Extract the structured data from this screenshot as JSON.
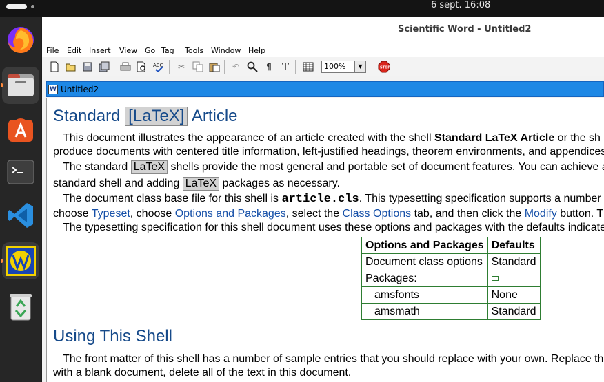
{
  "system": {
    "clock": "6 sept.  16:08"
  },
  "dock": {
    "items": [
      {
        "name": "firefox",
        "icon": "firefox-icon"
      },
      {
        "name": "files",
        "icon": "files-icon"
      },
      {
        "name": "app-center",
        "icon": "app-center-icon"
      },
      {
        "name": "terminal",
        "icon": "terminal-icon"
      },
      {
        "name": "vscode",
        "icon": "vscode-icon"
      },
      {
        "name": "scientific-word",
        "icon": "scientific-word-icon"
      },
      {
        "name": "trash",
        "icon": "trash-icon"
      }
    ]
  },
  "window": {
    "title": "Scientific Word - Untitled2",
    "menu": [
      "File",
      "Edit",
      "Insert",
      "View",
      "Go",
      "Tag",
      "Tools",
      "Window",
      "Help"
    ],
    "zoom": "100%",
    "doc_tab": "Untitled2"
  },
  "document": {
    "h1_pre": "Standard ",
    "h1_tag": "[LaTeX]",
    "h1_post": " Article",
    "p1a_pre": "This document illustrates the appearance of an article created with the shell ",
    "p1a_bold": "Standard LaTeX Article",
    "p1a_post": " or the sh",
    "p1b": "produce documents with centered title information, left-justified headings, theorem environments, and appendices.",
    "p2a_pre": "The standard ",
    "latex": "LaTeX",
    "p2a_post": " shells provide the most general and portable set of document features. You can achieve a",
    "p2b_pre": "standard shell and adding ",
    "p2b_post": " packages as necessary.",
    "p3a_pre": "The document class base file for this shell is ",
    "p3a_code": "article.cls",
    "p3a_post": ". This typesetting specification supports a number",
    "p3b_pre": "choose ",
    "p3b_link1": "Typeset",
    "p3b_mid1": ", choose ",
    "p3b_link2": "Options and Packages",
    "p3b_mid2": ", select the ",
    "p3b_link3": "Class Options",
    "p3b_mid3": " tab, and then click the ",
    "p3b_link4": "Modify",
    "p3b_post": " button. Th",
    "p4": "The typesetting specification for this shell document uses these options and packages with the defaults indicate",
    "table": {
      "headers": [
        "Options and Packages",
        "Defaults"
      ],
      "rows": [
        {
          "label": "Document class options",
          "value": "Standard",
          "sub": false
        },
        {
          "label": "Packages:",
          "value": "",
          "sub": false
        },
        {
          "label": "amsfonts",
          "value": "None",
          "sub": true
        },
        {
          "label": "amsmath",
          "value": "Standard",
          "sub": true
        }
      ]
    },
    "h2": "Using This Shell",
    "p5a": "The front matter of this shell has a number of sample entries that you should replace with your own. Replace the",
    "p5b": "with a blank document, delete all of the text in this document."
  }
}
